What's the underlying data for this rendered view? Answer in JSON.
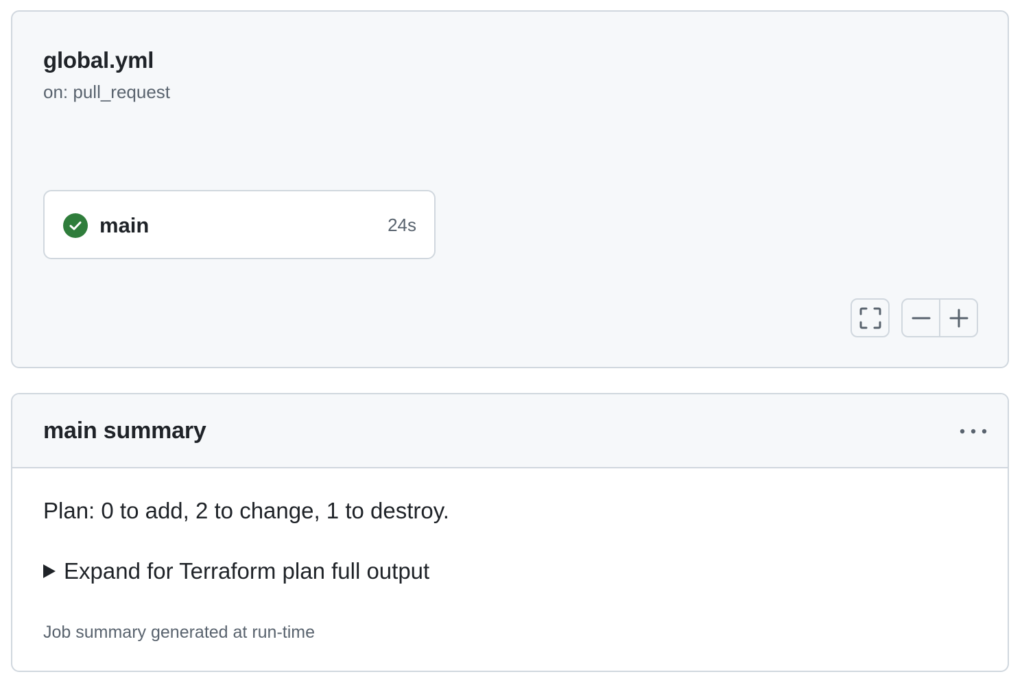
{
  "workflow": {
    "title": "global.yml",
    "trigger": "on: pull_request",
    "job": {
      "name": "main",
      "duration": "24s",
      "status": "success",
      "status_icon": "check-circle-icon",
      "status_color": "#2f7d3b"
    },
    "controls": {
      "fullscreen_icon": "fullscreen-icon",
      "zoom_out_icon": "minus-icon",
      "zoom_in_icon": "plus-icon"
    }
  },
  "summary": {
    "title": "main summary",
    "menu_icon": "kebab-horizontal-icon",
    "plan_text": "Plan: 0 to add, 2 to change, 1 to destroy.",
    "details_label": "Expand for Terraform plan full output",
    "footer": "Job summary generated at run-time"
  },
  "colors": {
    "card_background": "#f6f8fa",
    "border": "#d0d7de",
    "text_primary": "#1f2328",
    "text_muted": "#59636e"
  }
}
